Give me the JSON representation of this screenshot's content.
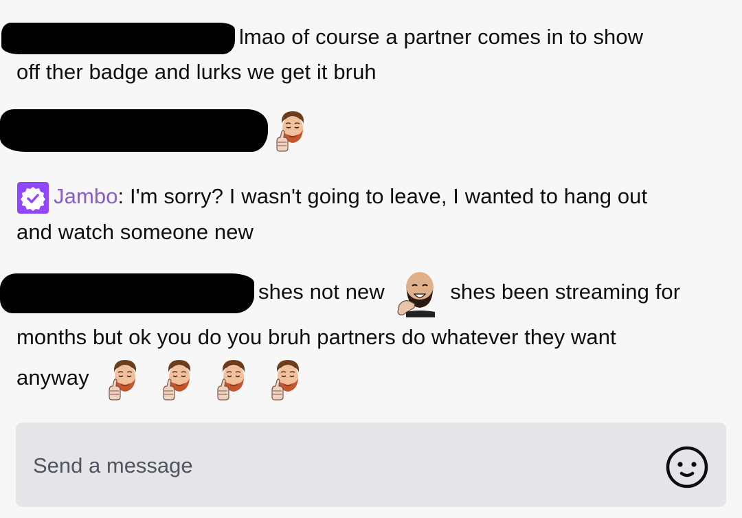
{
  "chat": {
    "messages": [
      {
        "username": "",
        "redacted": true,
        "text_line1": "lmao of course a partner comes in to show",
        "text_line2": "off ther badge and lurks we get it bruh",
        "emotes": []
      },
      {
        "username": "",
        "redacted": true,
        "text": "",
        "emotes": [
          "thumbs-up-face-emote"
        ]
      },
      {
        "username": "Jambo",
        "separator": ":",
        "badge": "partner-verified-badge-icon",
        "text_line1": "I'm sorry? I wasn't going to leave, I wanted to hang out",
        "text_line2": "and watch someone new"
      },
      {
        "username": "",
        "redacted": true,
        "text_part1": "shes not new",
        "emote_mid": "thinking-laugh-emote",
        "text_part2": "shes been streaming for",
        "text_line2": "months but ok you do you bruh partners do whatever they want",
        "text_line3": "anyway",
        "emotes_end": [
          "thumbs-up-face-emote",
          "thumbs-up-face-emote",
          "thumbs-up-face-emote",
          "thumbs-up-face-emote"
        ]
      }
    ]
  },
  "input": {
    "placeholder": "Send a message",
    "emoji_icon": "smiley-face-icon"
  },
  "colors": {
    "background": "#f7f7f8",
    "username_partner": "#8a5cc8",
    "badge": "#9147ff",
    "input_bg": "#e5e5e7"
  }
}
